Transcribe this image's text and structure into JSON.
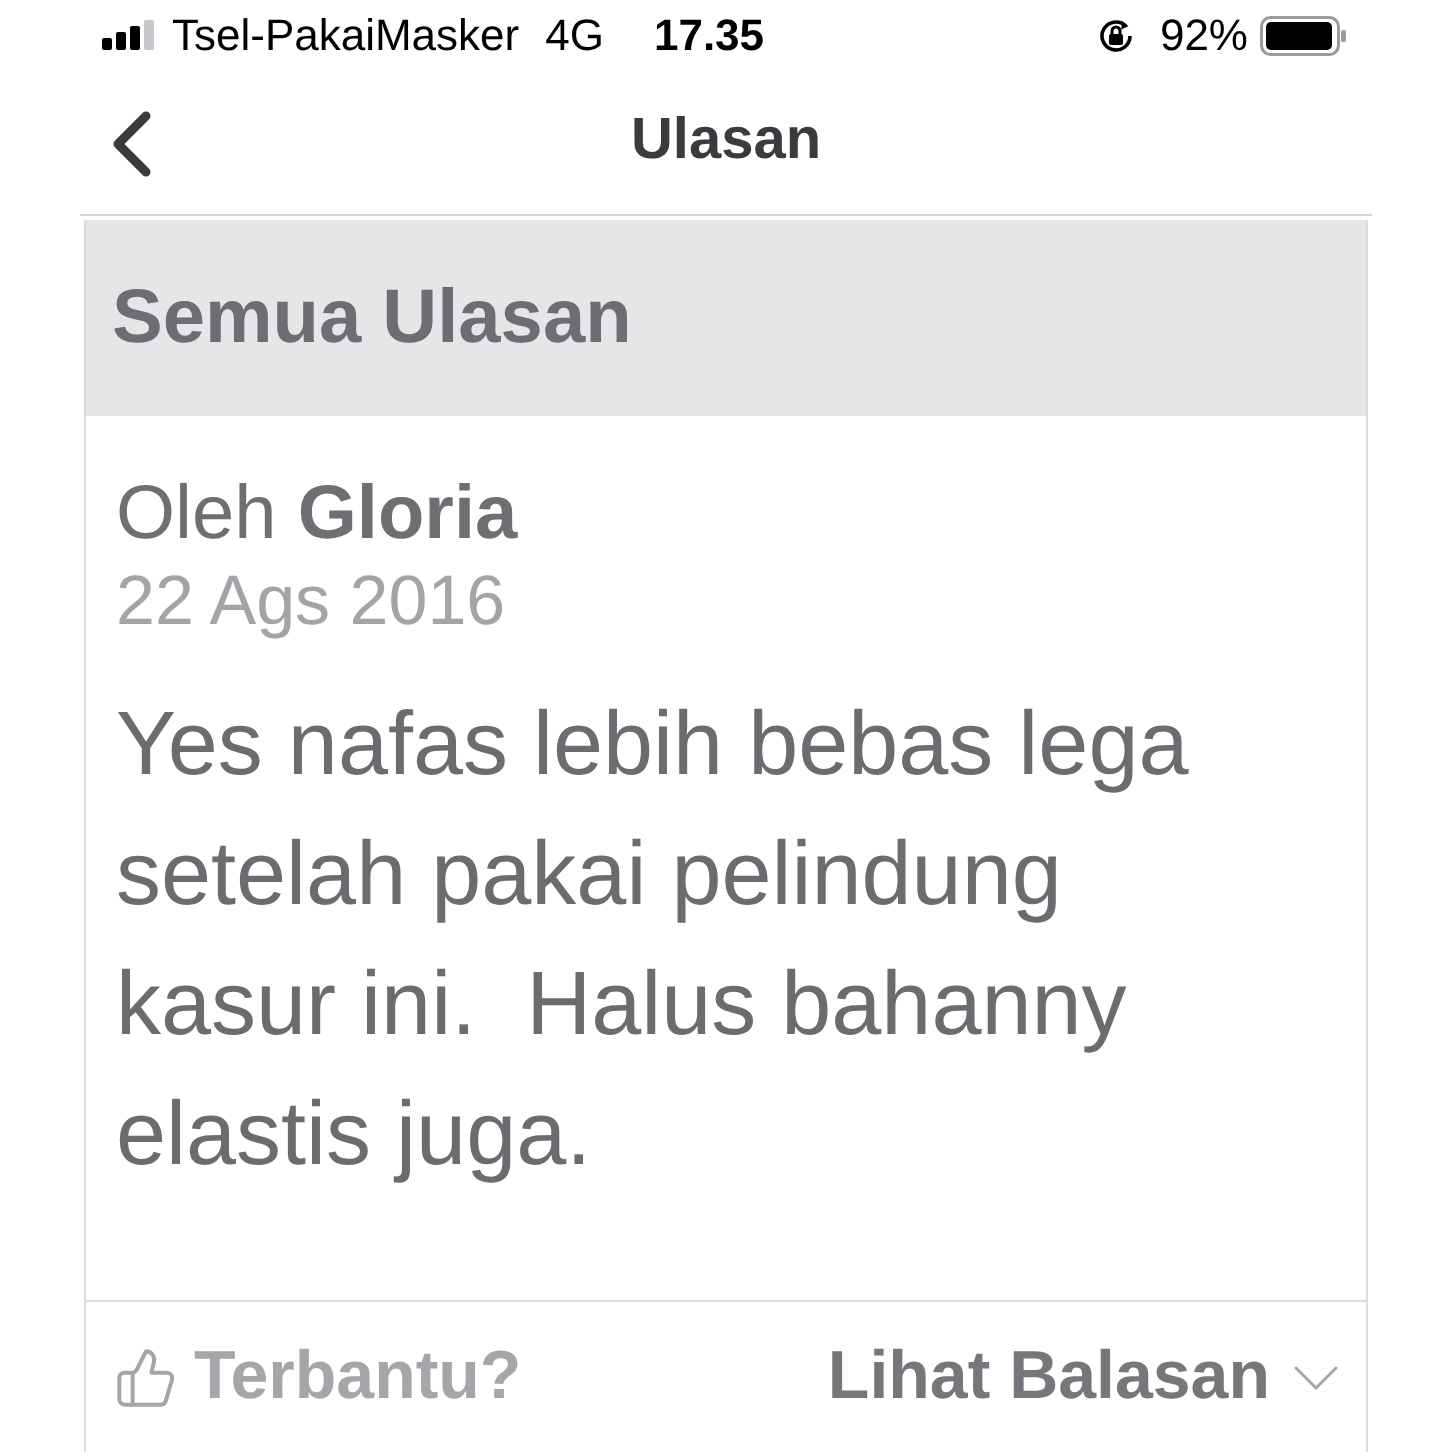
{
  "status_bar": {
    "carrier": "Tsel-PakaiMasker",
    "network": "4G",
    "time": "17.35",
    "battery": "92%"
  },
  "nav_bar": {
    "title": "Ulasan"
  },
  "section": {
    "title": "Semua Ulasan"
  },
  "review": {
    "author": "Oleh **Gloria**",
    "date": "22 Ags 2016",
    "text": "Yes nafas lebih bebas lega setelah pakai pelindung kasur ini.  Halus bahanny elastis juga.",
    "helpful": "Terbantu?",
    "replies": "Lihat Balasan"
  }
}
